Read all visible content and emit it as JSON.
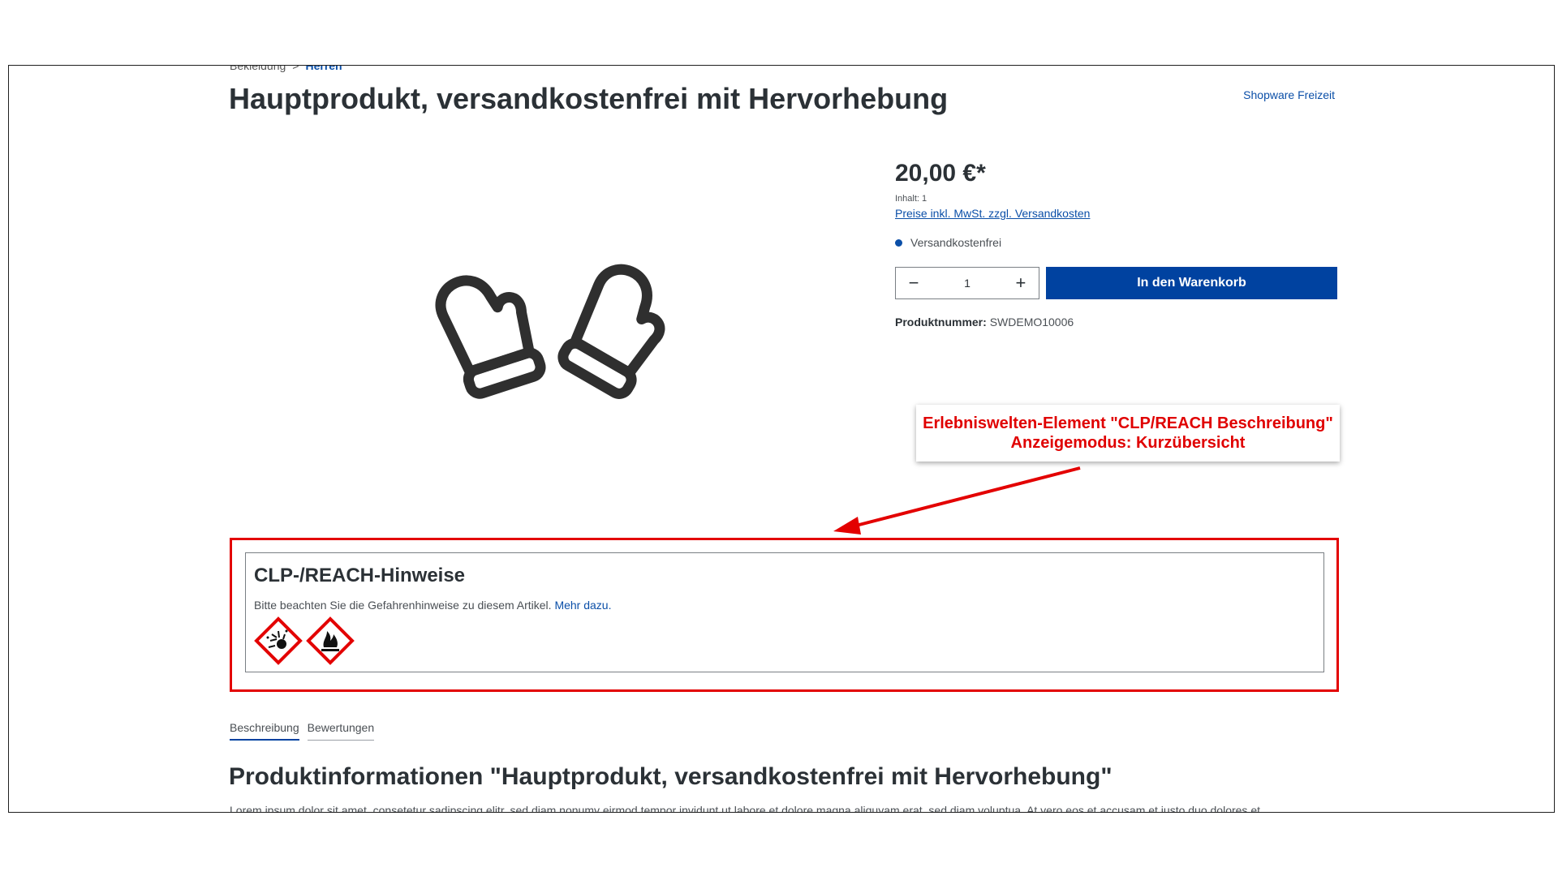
{
  "breadcrumb": {
    "parent": "Bekleidung",
    "separator": ">",
    "current": "Herren"
  },
  "product": {
    "title": "Hauptprodukt, versandkostenfrei mit Hervorhebung",
    "manufacturer": "Shopware Freizeit",
    "image_icon": "mittens-icon",
    "price": "20,00 €*",
    "content_unit": "Inhalt: 1",
    "tax_link": "Preise inkl. MwSt. zzgl. Versandkosten",
    "delivery_info": "Versandkostenfrei",
    "quantity": "1",
    "add_to_cart": "In den Warenkorb",
    "product_number_label": "Produktnummer:",
    "product_number": "SWDEMO10006"
  },
  "annotation": {
    "line1": "Erlebniswelten-Element \"CLP/REACH Beschreibung\"",
    "line2": "Anzeigemodus: Kurzübersicht",
    "color": "#e30000"
  },
  "clp": {
    "title": "CLP-/REACH-Hinweise",
    "text": "Bitte beachten Sie die Gefahrenhinweise zu diesem Artikel.",
    "link": "Mehr dazu.",
    "pictograms": [
      "explosive-pictogram-icon",
      "flammable-pictogram-icon"
    ]
  },
  "tabs": [
    "Beschreibung",
    "Bewertungen"
  ],
  "description": {
    "title": "Produktinformationen \"Hauptprodukt, versandkostenfrei mit Hervorhebung\"",
    "text": "Lorem ipsum dolor sit amet, consetetur sadipscing elitr, sed diam nonumy eirmod tempor invidunt ut labore et dolore magna aliquyam erat, sed diam voluptua. At vero eos et accusam et justo duo dolores et"
  },
  "colors": {
    "brand": "#0042a0",
    "link": "#0b4fa8",
    "text": "#2b3136",
    "hazard": "#e30000"
  }
}
